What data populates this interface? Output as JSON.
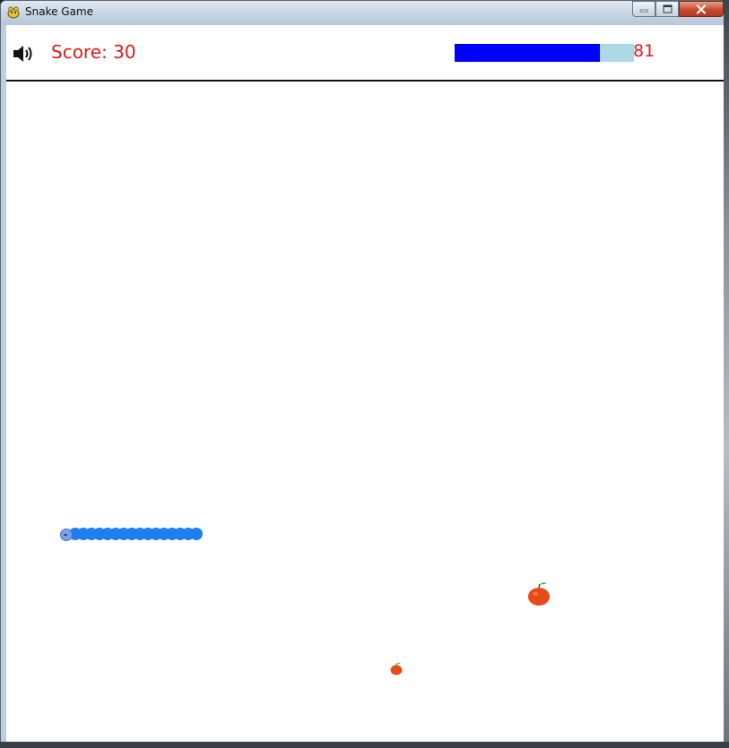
{
  "window": {
    "title": "Snake Game",
    "controls": [
      "minimize",
      "maximize",
      "close"
    ]
  },
  "hud": {
    "sound_icon": "speaker-volume-icon",
    "score_text": "Score: 30",
    "energy_value": 81,
    "energy_text": "81",
    "energy_fill_color": "#0000ff",
    "energy_track_color": "#add8e6",
    "text_color": "#e01a1a"
  },
  "game": {
    "snake_color": "#1e7ff0",
    "snake_head_color": "#7aa0ee",
    "snake_direction": "left",
    "snake_length": 17,
    "apples": [
      {
        "name": "apple-large"
      },
      {
        "name": "apple-small"
      }
    ]
  }
}
